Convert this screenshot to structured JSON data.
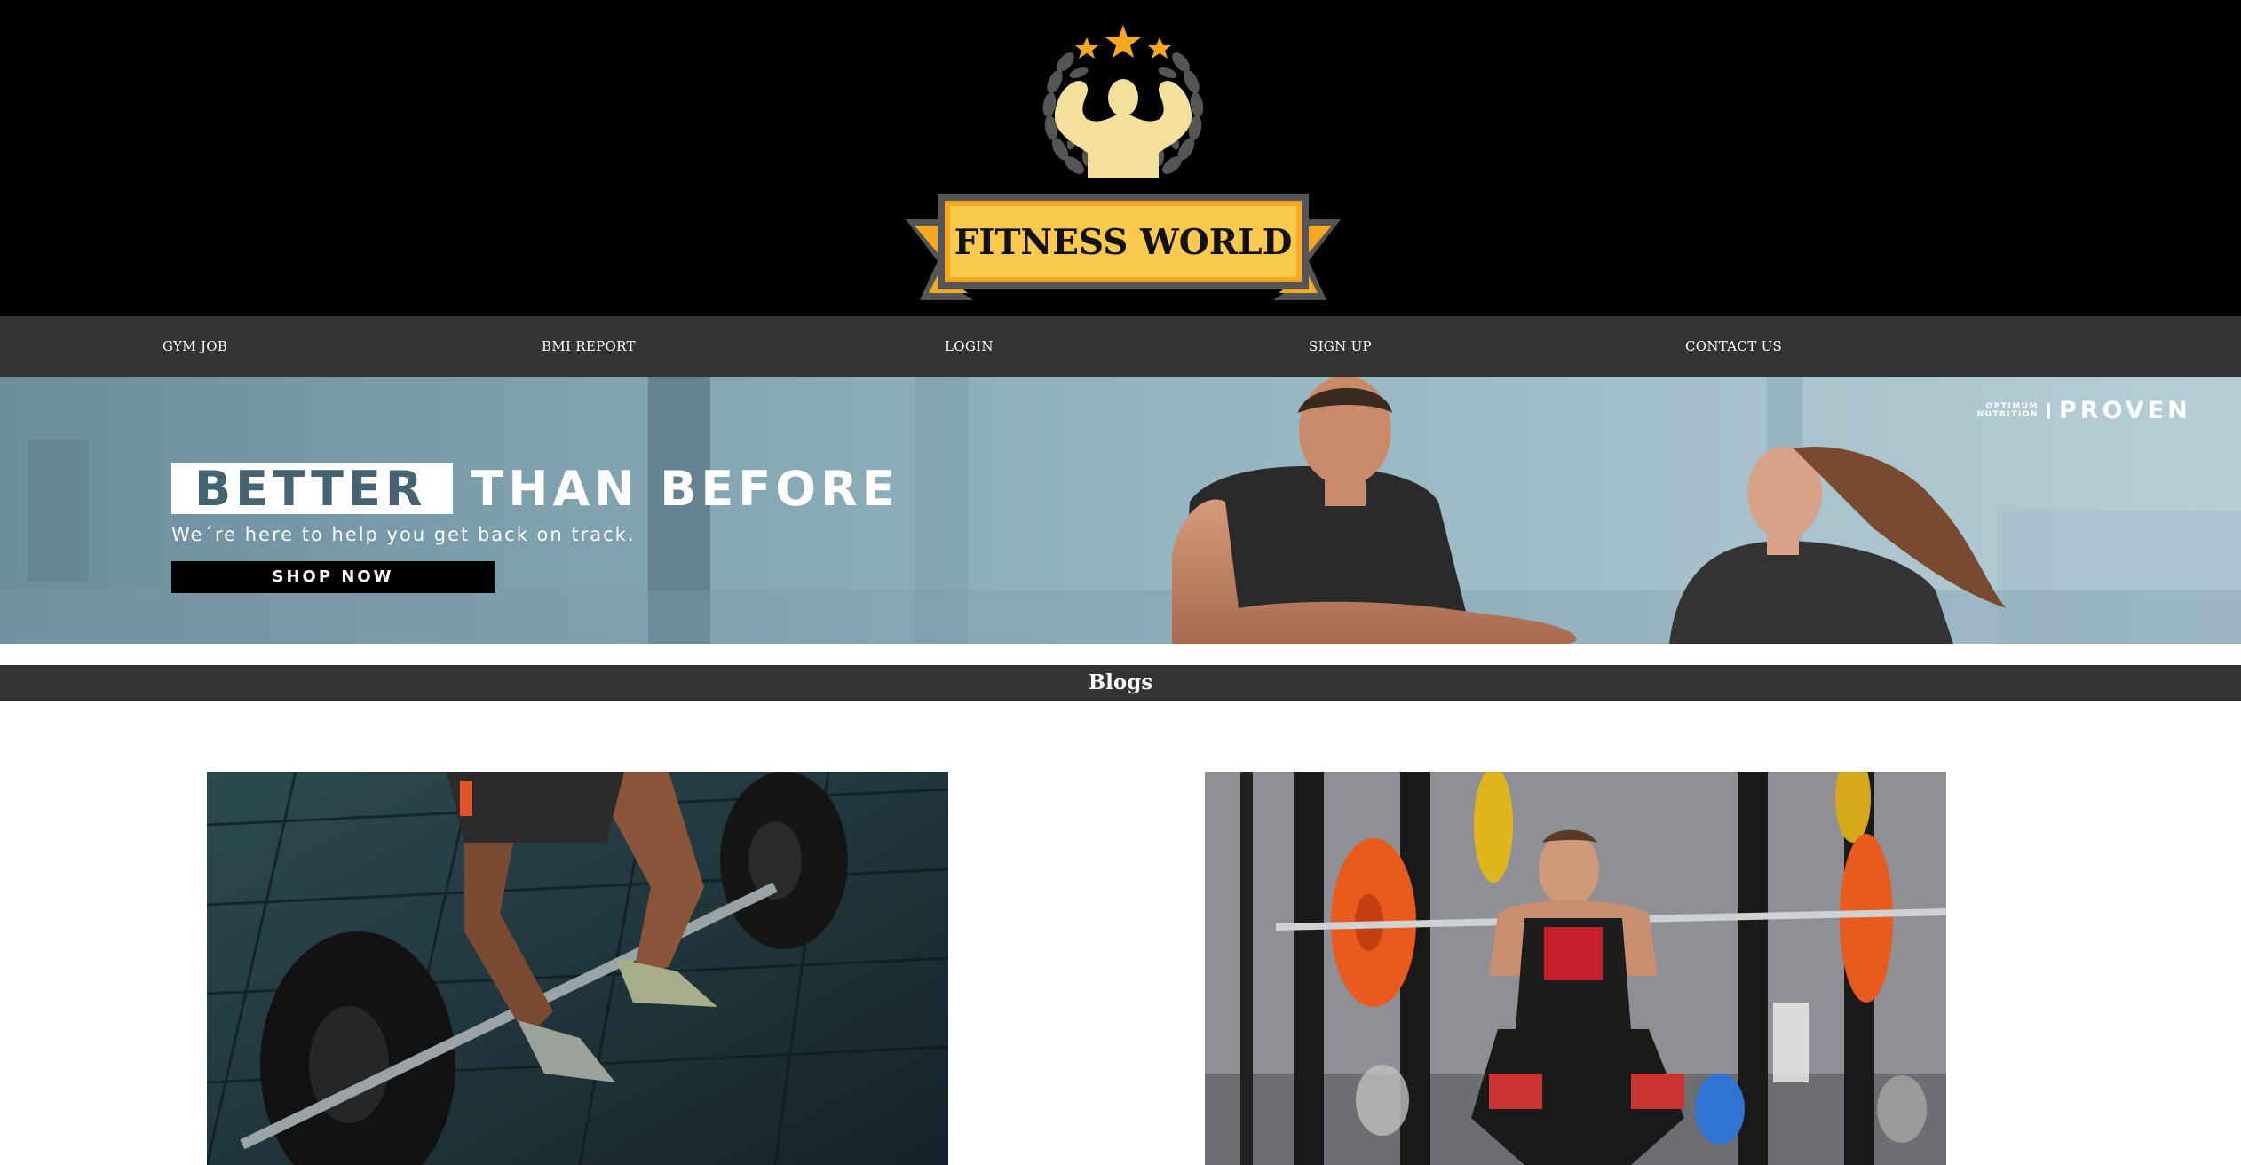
{
  "brand": {
    "name": "FITNESS WORLD",
    "colors": {
      "gold": "#f7a823",
      "light_gold": "#fbd468",
      "body_tan": "#f4e09a",
      "laurel": "#555555"
    }
  },
  "nav": {
    "items": [
      {
        "label": "GYM JOB"
      },
      {
        "label": "BMI REPORT"
      },
      {
        "label": "LOGIN"
      },
      {
        "label": "SIGN UP"
      },
      {
        "label": "CONTACT US"
      }
    ]
  },
  "banner": {
    "headline_highlight": "BETTER",
    "headline_rest": "THAN BEFORE",
    "subtext": "We´re here to help you get back on track.",
    "cta": "SHOP NOW",
    "brand_small": "OPTIMUM NUTRITION",
    "brand_large": "PROVEN"
  },
  "blogs": {
    "title": "Blogs",
    "cards": [
      {
        "image": "deadlift-barbell-photo"
      },
      {
        "image": "squat-rack-photo"
      }
    ]
  }
}
